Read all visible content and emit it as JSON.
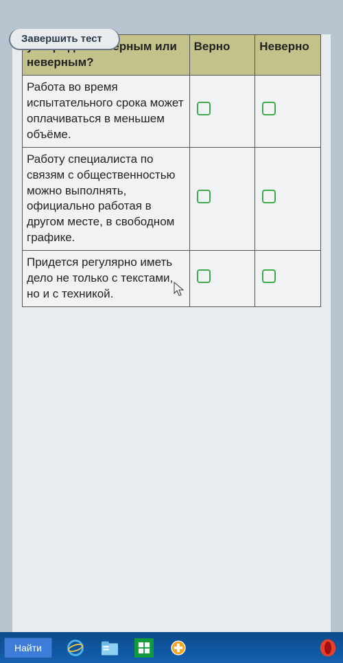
{
  "top_button": "Завершить тест",
  "table": {
    "header": {
      "statement": "утверждение верным или неверным?",
      "true": "Верно",
      "false": "Неверно"
    },
    "rows": [
      {
        "statement": "Работа во время испытательного срока может оплачиваться в меньшем объёме."
      },
      {
        "statement": "Работу специалиста по связям с общественностью можно выполнять, официально работая в другом месте, в свободном графике."
      },
      {
        "statement": "Придется регулярно иметь дело не только с текстами, но и с техникой."
      }
    ]
  },
  "taskbar": {
    "search": "Найти"
  }
}
